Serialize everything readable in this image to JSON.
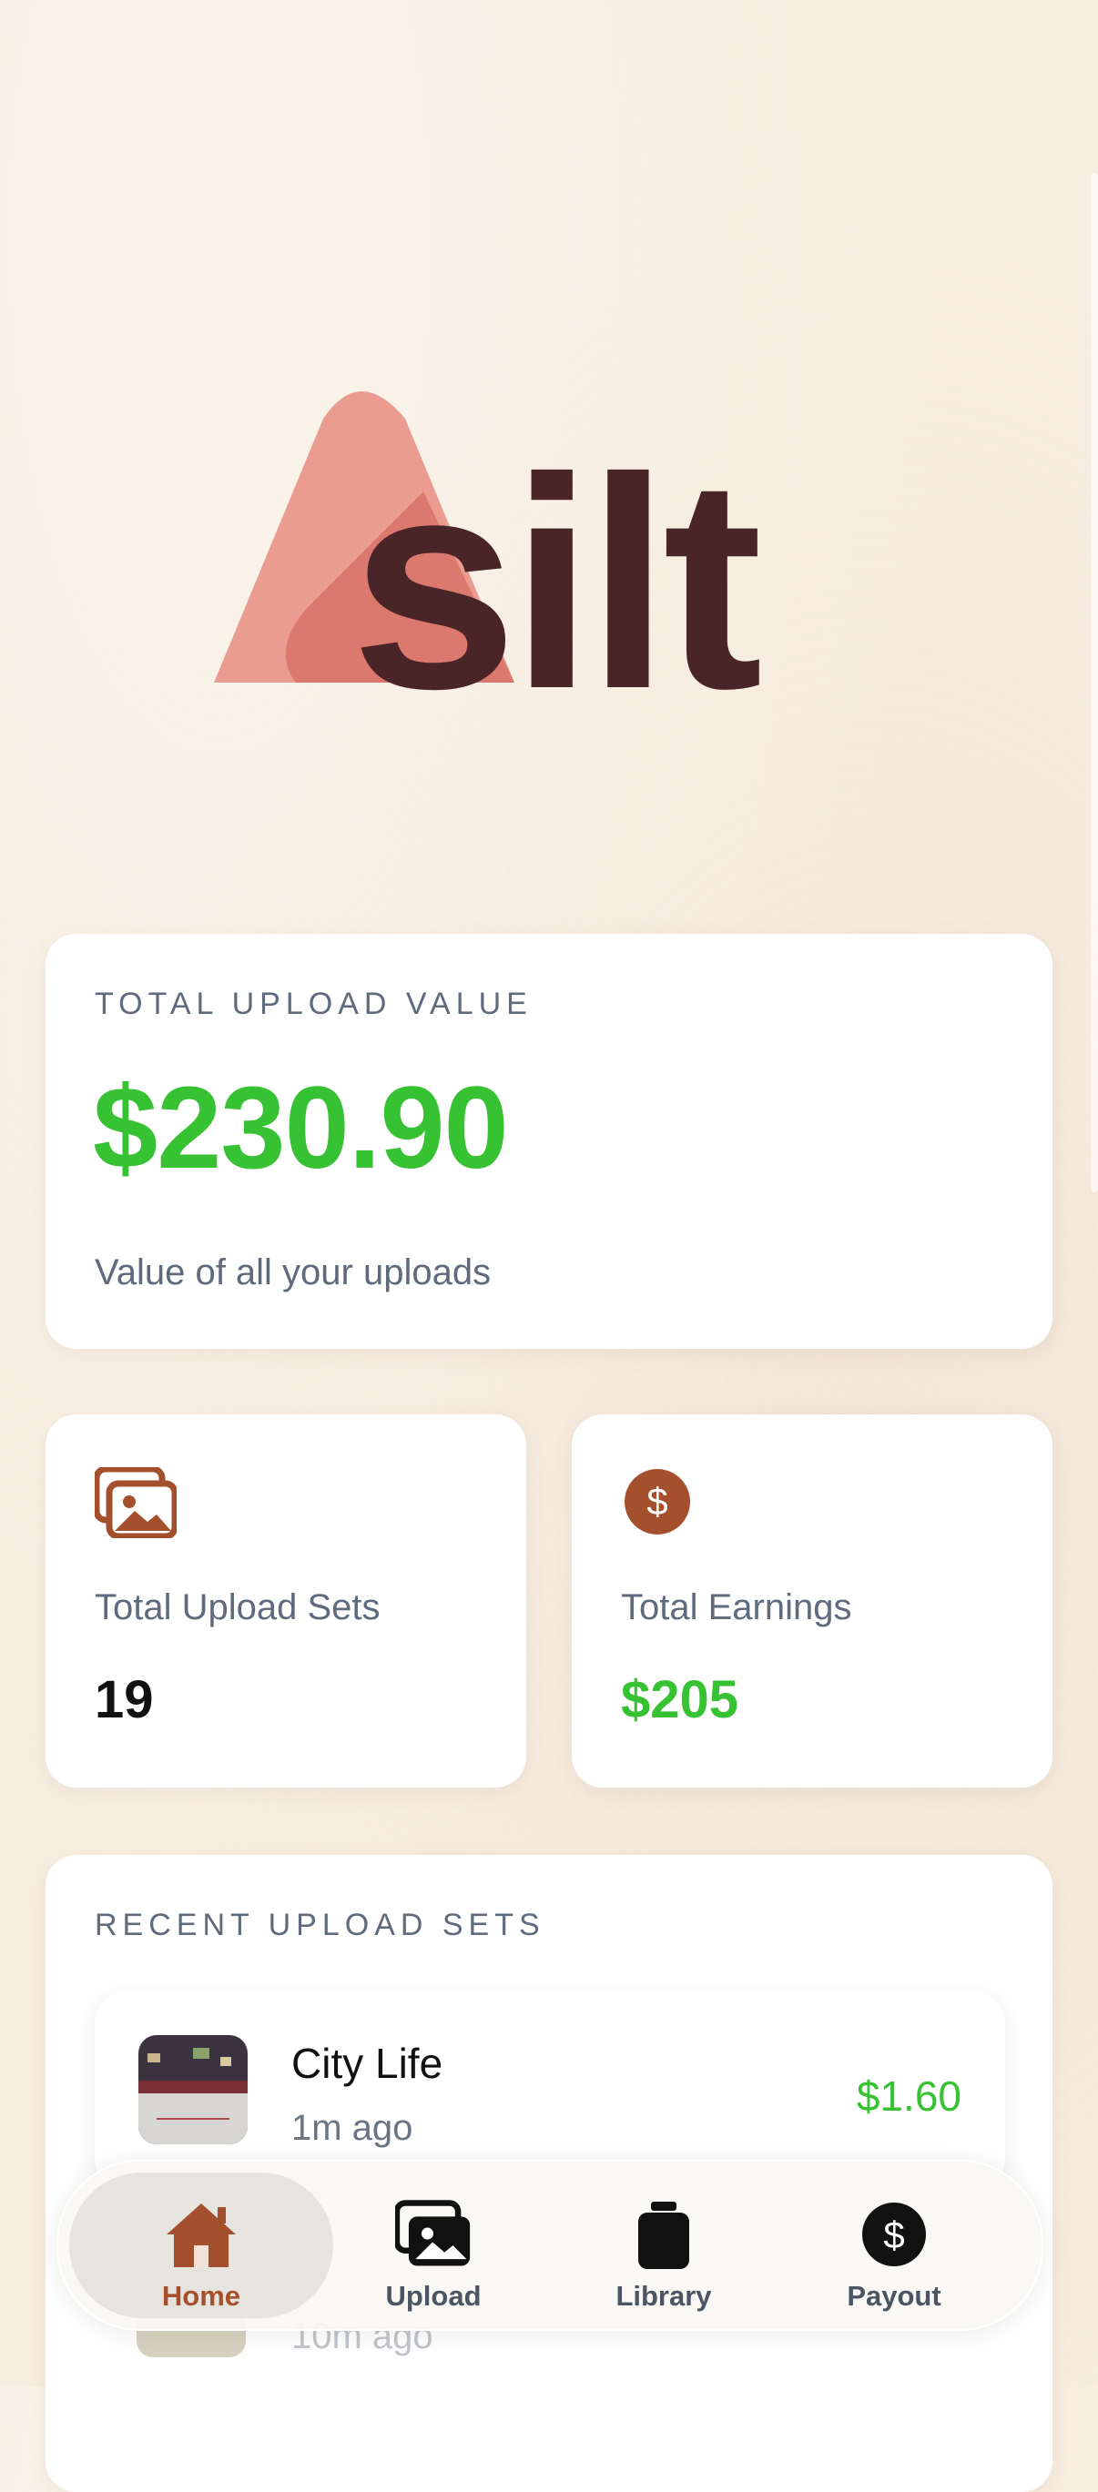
{
  "brand": {
    "name": "silt"
  },
  "total_card": {
    "eyebrow": "TOTAL UPLOAD VALUE",
    "value": "$230.90",
    "subtitle": "Value of all your uploads"
  },
  "stats": [
    {
      "label": "Total Upload Sets",
      "value": "19",
      "icon": "images-icon"
    },
    {
      "label": "Total Earnings",
      "value": "$205",
      "icon": "dollar-circle-icon"
    }
  ],
  "recent": {
    "eyebrow": "RECENT UPLOAD SETS",
    "items": [
      {
        "title": "City Life",
        "time": "1m ago",
        "price": "$1.60"
      },
      {
        "time": "10m ago"
      }
    ]
  },
  "tabbar": {
    "tabs": [
      {
        "label": "Home",
        "icon": "home-icon",
        "active": true
      },
      {
        "label": "Upload",
        "icon": "images-icon"
      },
      {
        "label": "Library",
        "icon": "jar-icon"
      },
      {
        "label": "Payout",
        "icon": "dollar-circle-icon"
      }
    ]
  },
  "colors": {
    "accent_green": "#36c232",
    "accent_brown": "#a5502d",
    "logo_dark": "#4a2528",
    "logo_pink": "#e8978a"
  }
}
